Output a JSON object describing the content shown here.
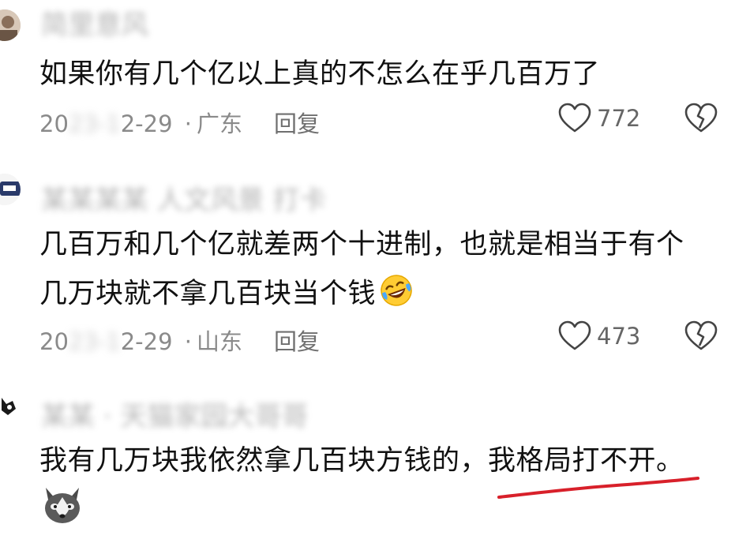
{
  "comments": [
    {
      "username": "简里意风",
      "text_lines": [
        "如果你有几个亿以上真的不怎么在乎几百万了"
      ],
      "date_prefix": "20",
      "date_hidden": "23-1",
      "date_suffix": "2-29",
      "location": "广东",
      "reply_label": "回复",
      "likes": "772"
    },
    {
      "username": "某某某某 人文风景 打卡",
      "text_lines": [
        "几百万和几个亿就差两个十进制，也就是相当于有个",
        "几万块就不拿几百块当个钱"
      ],
      "date_prefix": "20",
      "date_hidden": "23-1",
      "date_suffix": "2-29",
      "location": "山东",
      "reply_label": "回复",
      "likes": "473",
      "emoji": "laughing-crying-emoji"
    },
    {
      "username": "某某 · 天猫家园大哥哥",
      "text_main": "我有几万块我依然拿几百块方钱的，",
      "text_highlight": "我格局打不开。",
      "emoji": "husky-dog-emoji",
      "highlight_color": "#d8202a"
    }
  ],
  "separator": "·"
}
